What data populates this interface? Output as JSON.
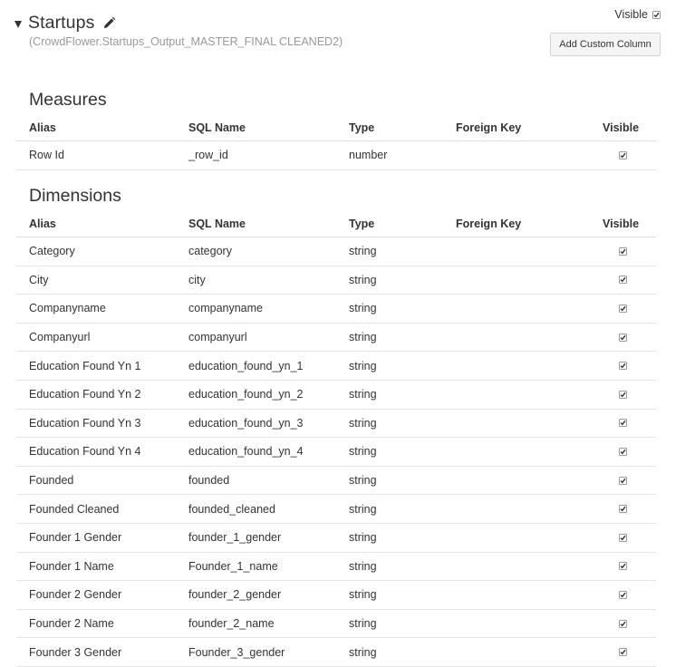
{
  "header": {
    "title": "Startups",
    "subtitle": "(CrowdFlower.Startups_Output_MASTER_FINAL CLEANED2)",
    "visible_label": "Visible",
    "visible_checked": true,
    "add_custom_column_label": "Add Custom Column"
  },
  "columns": {
    "alias": "Alias",
    "sql_name": "SQL Name",
    "type": "Type",
    "foreign_key": "Foreign Key",
    "visible": "Visible"
  },
  "measures": {
    "title": "Measures",
    "rows": [
      {
        "alias": "Row Id",
        "sql_name": "_row_id",
        "type": "number",
        "foreign_key": "",
        "visible": true
      }
    ]
  },
  "dimensions": {
    "title": "Dimensions",
    "rows": [
      {
        "alias": "Category",
        "sql_name": "category",
        "type": "string",
        "foreign_key": "",
        "visible": true
      },
      {
        "alias": "City",
        "sql_name": "city",
        "type": "string",
        "foreign_key": "",
        "visible": true
      },
      {
        "alias": "Companyname",
        "sql_name": "companyname",
        "type": "string",
        "foreign_key": "",
        "visible": true
      },
      {
        "alias": "Companyurl",
        "sql_name": "companyurl",
        "type": "string",
        "foreign_key": "",
        "visible": true
      },
      {
        "alias": "Education Found Yn 1",
        "sql_name": "education_found_yn_1",
        "type": "string",
        "foreign_key": "",
        "visible": true
      },
      {
        "alias": "Education Found Yn 2",
        "sql_name": "education_found_yn_2",
        "type": "string",
        "foreign_key": "",
        "visible": true
      },
      {
        "alias": "Education Found Yn 3",
        "sql_name": "education_found_yn_3",
        "type": "string",
        "foreign_key": "",
        "visible": true
      },
      {
        "alias": "Education Found Yn 4",
        "sql_name": "education_found_yn_4",
        "type": "string",
        "foreign_key": "",
        "visible": true
      },
      {
        "alias": "Founded",
        "sql_name": "founded",
        "type": "string",
        "foreign_key": "",
        "visible": true
      },
      {
        "alias": "Founded Cleaned",
        "sql_name": "founded_cleaned",
        "type": "string",
        "foreign_key": "",
        "visible": true
      },
      {
        "alias": "Founder 1 Gender",
        "sql_name": "founder_1_gender",
        "type": "string",
        "foreign_key": "",
        "visible": true
      },
      {
        "alias": "Founder 1 Name",
        "sql_name": "Founder_1_name",
        "type": "string",
        "foreign_key": "",
        "visible": true
      },
      {
        "alias": "Founder 2 Gender",
        "sql_name": "founder_2_gender",
        "type": "string",
        "foreign_key": "",
        "visible": true
      },
      {
        "alias": "Founder 2 Name",
        "sql_name": "founder_2_name",
        "type": "string",
        "foreign_key": "",
        "visible": true
      },
      {
        "alias": "Founder 3 Gender",
        "sql_name": "Founder_3_gender",
        "type": "string",
        "foreign_key": "",
        "visible": true
      }
    ]
  },
  "icons": {
    "collapse": "caret-down-icon",
    "edit": "pencil-icon",
    "check": "checkmark-icon"
  },
  "colors": {
    "text": "#333333",
    "muted": "#999999",
    "border": "#e5e5e5",
    "button_bg": "#f5f5f5"
  }
}
